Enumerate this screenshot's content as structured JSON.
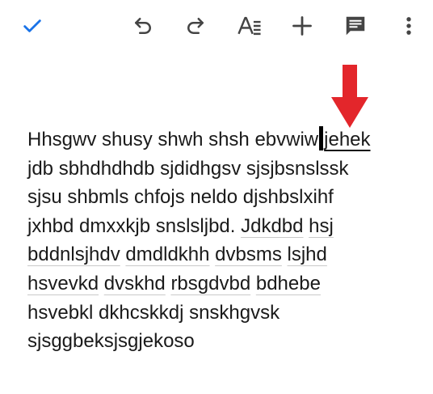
{
  "toolbar": {
    "done_icon": "check-icon",
    "undo_icon": "undo-icon",
    "redo_icon": "redo-icon",
    "format_icon": "text-format-icon",
    "insert_icon": "plus-icon",
    "comment_icon": "comment-icon",
    "more_icon": "more-vertical-icon",
    "accent_color": "#1a73e8",
    "icon_color": "#444444"
  },
  "annotation": {
    "arrow_color": "#e3262b"
  },
  "document": {
    "lines": [
      {
        "segments": [
          {
            "text": "Hhsgwv shusy shwh shsh ebvwiw",
            "style": "plain"
          },
          {
            "caret": true
          },
          {
            "text": "jehek",
            "style": "selected"
          }
        ]
      },
      {
        "segments": [
          {
            "text": "jdb sbhdhdhdb sjdidhgsv sjsjbsnslssk",
            "style": "plain"
          }
        ]
      },
      {
        "segments": [
          {
            "text": "sjsu shbmls chfojs neldo djshbslxihf",
            "style": "plain"
          }
        ]
      },
      {
        "segments": [
          {
            "text": "jxhbd dmxxkjb snslsljbd. ",
            "style": "plain"
          },
          {
            "text": "Jdkdbd",
            "style": "spell"
          },
          {
            "text": " ",
            "style": "plain"
          },
          {
            "text": "hsj",
            "style": "spell"
          }
        ]
      },
      {
        "segments": [
          {
            "text": "bddnlsjhdv",
            "style": "spell"
          },
          {
            "text": " ",
            "style": "plain"
          },
          {
            "text": "dmdldkhh",
            "style": "spell"
          },
          {
            "text": " ",
            "style": "plain"
          },
          {
            "text": "dvbsms",
            "style": "spell"
          },
          {
            "text": " ",
            "style": "plain"
          },
          {
            "text": "lsjhd",
            "style": "spell"
          }
        ]
      },
      {
        "segments": [
          {
            "text": "hsvevkd",
            "style": "spell"
          },
          {
            "text": " ",
            "style": "plain"
          },
          {
            "text": "dvskhd",
            "style": "spell"
          },
          {
            "text": " ",
            "style": "plain"
          },
          {
            "text": "rbsgdvbd",
            "style": "spell"
          },
          {
            "text": " ",
            "style": "plain"
          },
          {
            "text": "bdhebe",
            "style": "spell"
          }
        ]
      },
      {
        "segments": [
          {
            "text": "hsvebkl dkhcskkdj snskhgvsk",
            "style": "plain"
          }
        ]
      },
      {
        "segments": [
          {
            "text": "sjsggbeksjsgjekoso",
            "style": "plain"
          }
        ]
      }
    ]
  }
}
